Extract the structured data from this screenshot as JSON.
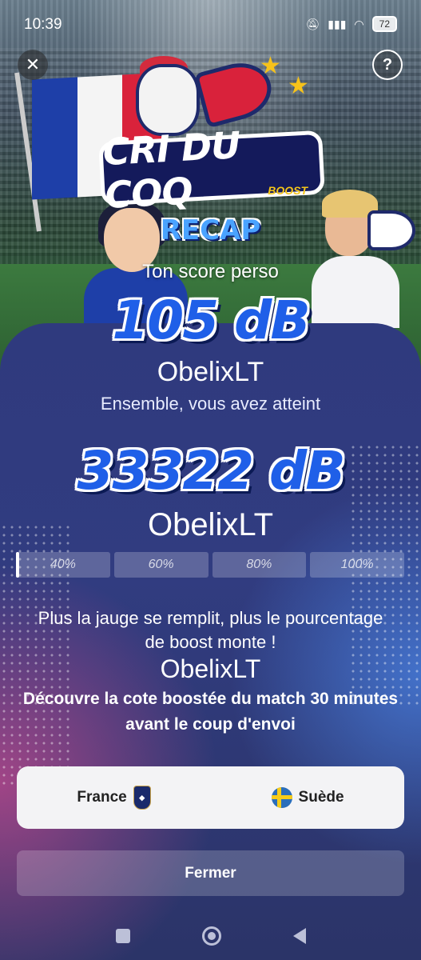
{
  "status_bar": {
    "time": "10:39",
    "battery": "72"
  },
  "header": {
    "close_icon": "close-icon",
    "help_icon": "help-icon",
    "help_glyph": "?"
  },
  "logo": {
    "title": "CRI DU COQ",
    "subtitle": "BOOST"
  },
  "recap": {
    "title": "RECAP",
    "score_label": "Ton score perso",
    "personal_score": "105 dB",
    "username": "ObelixLT",
    "together_label": "Ensemble, vous avez atteint",
    "team_score": "33322 dB",
    "team_username": "ObelixLT"
  },
  "gauge": {
    "segments": [
      "40%",
      "60%",
      "80%",
      "100%"
    ],
    "fill_fraction_first_segment": 0.03
  },
  "info": {
    "description": "Plus la jauge se remplit, plus le pourcentage de boost monte !",
    "username": "ObelixLT",
    "cta": "Découvre la cote boostée du match 30 minutes avant le coup d'envoi"
  },
  "match": {
    "home_team": "France",
    "away_team": "Suède"
  },
  "actions": {
    "close_label": "Fermer"
  },
  "colors": {
    "accent_blue": "#1f5fe8",
    "panel_bg": "#313c80",
    "france_blue": "#1e3fa8",
    "france_red": "#d9223b"
  }
}
